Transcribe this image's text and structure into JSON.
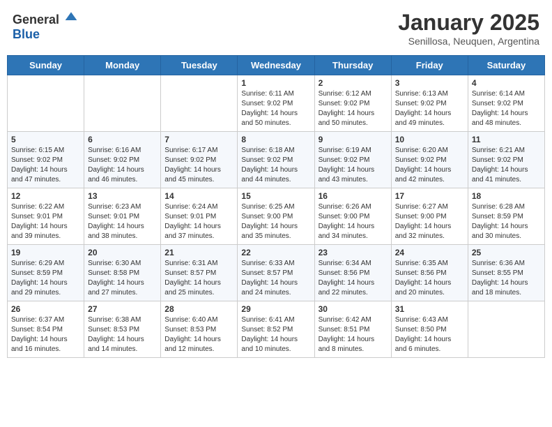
{
  "header": {
    "logo_general": "General",
    "logo_blue": "Blue",
    "month": "January 2025",
    "location": "Senillosa, Neuquen, Argentina"
  },
  "days_of_week": [
    "Sunday",
    "Monday",
    "Tuesday",
    "Wednesday",
    "Thursday",
    "Friday",
    "Saturday"
  ],
  "weeks": [
    [
      {
        "day": "",
        "sunrise": "",
        "sunset": "",
        "daylight": ""
      },
      {
        "day": "",
        "sunrise": "",
        "sunset": "",
        "daylight": ""
      },
      {
        "day": "",
        "sunrise": "",
        "sunset": "",
        "daylight": ""
      },
      {
        "day": "1",
        "sunrise": "Sunrise: 6:11 AM",
        "sunset": "Sunset: 9:02 PM",
        "daylight": "Daylight: 14 hours and 50 minutes."
      },
      {
        "day": "2",
        "sunrise": "Sunrise: 6:12 AM",
        "sunset": "Sunset: 9:02 PM",
        "daylight": "Daylight: 14 hours and 50 minutes."
      },
      {
        "day": "3",
        "sunrise": "Sunrise: 6:13 AM",
        "sunset": "Sunset: 9:02 PM",
        "daylight": "Daylight: 14 hours and 49 minutes."
      },
      {
        "day": "4",
        "sunrise": "Sunrise: 6:14 AM",
        "sunset": "Sunset: 9:02 PM",
        "daylight": "Daylight: 14 hours and 48 minutes."
      }
    ],
    [
      {
        "day": "5",
        "sunrise": "Sunrise: 6:15 AM",
        "sunset": "Sunset: 9:02 PM",
        "daylight": "Daylight: 14 hours and 47 minutes."
      },
      {
        "day": "6",
        "sunrise": "Sunrise: 6:16 AM",
        "sunset": "Sunset: 9:02 PM",
        "daylight": "Daylight: 14 hours and 46 minutes."
      },
      {
        "day": "7",
        "sunrise": "Sunrise: 6:17 AM",
        "sunset": "Sunset: 9:02 PM",
        "daylight": "Daylight: 14 hours and 45 minutes."
      },
      {
        "day": "8",
        "sunrise": "Sunrise: 6:18 AM",
        "sunset": "Sunset: 9:02 PM",
        "daylight": "Daylight: 14 hours and 44 minutes."
      },
      {
        "day": "9",
        "sunrise": "Sunrise: 6:19 AM",
        "sunset": "Sunset: 9:02 PM",
        "daylight": "Daylight: 14 hours and 43 minutes."
      },
      {
        "day": "10",
        "sunrise": "Sunrise: 6:20 AM",
        "sunset": "Sunset: 9:02 PM",
        "daylight": "Daylight: 14 hours and 42 minutes."
      },
      {
        "day": "11",
        "sunrise": "Sunrise: 6:21 AM",
        "sunset": "Sunset: 9:02 PM",
        "daylight": "Daylight: 14 hours and 41 minutes."
      }
    ],
    [
      {
        "day": "12",
        "sunrise": "Sunrise: 6:22 AM",
        "sunset": "Sunset: 9:01 PM",
        "daylight": "Daylight: 14 hours and 39 minutes."
      },
      {
        "day": "13",
        "sunrise": "Sunrise: 6:23 AM",
        "sunset": "Sunset: 9:01 PM",
        "daylight": "Daylight: 14 hours and 38 minutes."
      },
      {
        "day": "14",
        "sunrise": "Sunrise: 6:24 AM",
        "sunset": "Sunset: 9:01 PM",
        "daylight": "Daylight: 14 hours and 37 minutes."
      },
      {
        "day": "15",
        "sunrise": "Sunrise: 6:25 AM",
        "sunset": "Sunset: 9:00 PM",
        "daylight": "Daylight: 14 hours and 35 minutes."
      },
      {
        "day": "16",
        "sunrise": "Sunrise: 6:26 AM",
        "sunset": "Sunset: 9:00 PM",
        "daylight": "Daylight: 14 hours and 34 minutes."
      },
      {
        "day": "17",
        "sunrise": "Sunrise: 6:27 AM",
        "sunset": "Sunset: 9:00 PM",
        "daylight": "Daylight: 14 hours and 32 minutes."
      },
      {
        "day": "18",
        "sunrise": "Sunrise: 6:28 AM",
        "sunset": "Sunset: 8:59 PM",
        "daylight": "Daylight: 14 hours and 30 minutes."
      }
    ],
    [
      {
        "day": "19",
        "sunrise": "Sunrise: 6:29 AM",
        "sunset": "Sunset: 8:59 PM",
        "daylight": "Daylight: 14 hours and 29 minutes."
      },
      {
        "day": "20",
        "sunrise": "Sunrise: 6:30 AM",
        "sunset": "Sunset: 8:58 PM",
        "daylight": "Daylight: 14 hours and 27 minutes."
      },
      {
        "day": "21",
        "sunrise": "Sunrise: 6:31 AM",
        "sunset": "Sunset: 8:57 PM",
        "daylight": "Daylight: 14 hours and 25 minutes."
      },
      {
        "day": "22",
        "sunrise": "Sunrise: 6:33 AM",
        "sunset": "Sunset: 8:57 PM",
        "daylight": "Daylight: 14 hours and 24 minutes."
      },
      {
        "day": "23",
        "sunrise": "Sunrise: 6:34 AM",
        "sunset": "Sunset: 8:56 PM",
        "daylight": "Daylight: 14 hours and 22 minutes."
      },
      {
        "day": "24",
        "sunrise": "Sunrise: 6:35 AM",
        "sunset": "Sunset: 8:56 PM",
        "daylight": "Daylight: 14 hours and 20 minutes."
      },
      {
        "day": "25",
        "sunrise": "Sunrise: 6:36 AM",
        "sunset": "Sunset: 8:55 PM",
        "daylight": "Daylight: 14 hours and 18 minutes."
      }
    ],
    [
      {
        "day": "26",
        "sunrise": "Sunrise: 6:37 AM",
        "sunset": "Sunset: 8:54 PM",
        "daylight": "Daylight: 14 hours and 16 minutes."
      },
      {
        "day": "27",
        "sunrise": "Sunrise: 6:38 AM",
        "sunset": "Sunset: 8:53 PM",
        "daylight": "Daylight: 14 hours and 14 minutes."
      },
      {
        "day": "28",
        "sunrise": "Sunrise: 6:40 AM",
        "sunset": "Sunset: 8:53 PM",
        "daylight": "Daylight: 14 hours and 12 minutes."
      },
      {
        "day": "29",
        "sunrise": "Sunrise: 6:41 AM",
        "sunset": "Sunset: 8:52 PM",
        "daylight": "Daylight: 14 hours and 10 minutes."
      },
      {
        "day": "30",
        "sunrise": "Sunrise: 6:42 AM",
        "sunset": "Sunset: 8:51 PM",
        "daylight": "Daylight: 14 hours and 8 minutes."
      },
      {
        "day": "31",
        "sunrise": "Sunrise: 6:43 AM",
        "sunset": "Sunset: 8:50 PM",
        "daylight": "Daylight: 14 hours and 6 minutes."
      },
      {
        "day": "",
        "sunrise": "",
        "sunset": "",
        "daylight": ""
      }
    ]
  ]
}
